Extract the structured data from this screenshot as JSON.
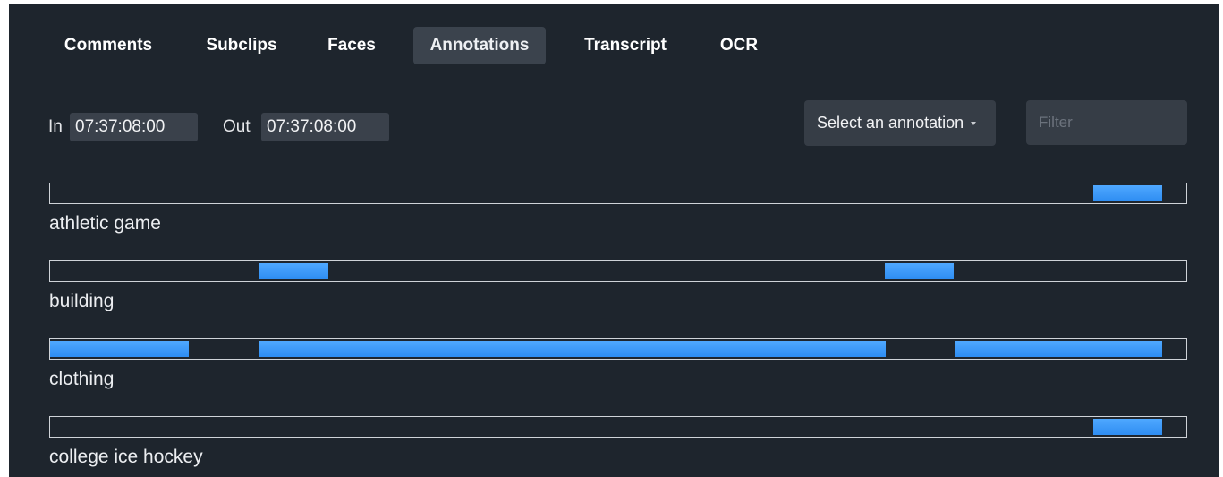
{
  "tabs": [
    {
      "label": "Comments",
      "active": false
    },
    {
      "label": "Subclips",
      "active": false
    },
    {
      "label": "Faces",
      "active": false
    },
    {
      "label": "Annotations",
      "active": true
    },
    {
      "label": "Transcript",
      "active": false
    },
    {
      "label": "OCR",
      "active": false
    }
  ],
  "range": {
    "in_label": "In",
    "in_value": "07:37:08:00",
    "out_label": "Out",
    "out_value": "07:37:08:00"
  },
  "annotation_select": {
    "value": "Select an annotation"
  },
  "filter": {
    "value": "",
    "placeholder": "Filter"
  },
  "annotations": [
    {
      "label": "athletic game",
      "segments": [
        [
          0.918,
          0.979
        ]
      ]
    },
    {
      "label": "building",
      "segments": [
        [
          0.184,
          0.245
        ],
        [
          0.735,
          0.796
        ]
      ]
    },
    {
      "label": "clothing",
      "segments": [
        [
          0.0,
          0.122
        ],
        [
          0.184,
          0.735
        ],
        [
          0.796,
          0.979
        ]
      ]
    },
    {
      "label": "college ice hockey",
      "segments": [
        [
          0.918,
          0.979
        ]
      ]
    }
  ],
  "colors": {
    "background": "#1e252d",
    "segment": "#3b9bff",
    "track_border": "#cfd3d8"
  }
}
